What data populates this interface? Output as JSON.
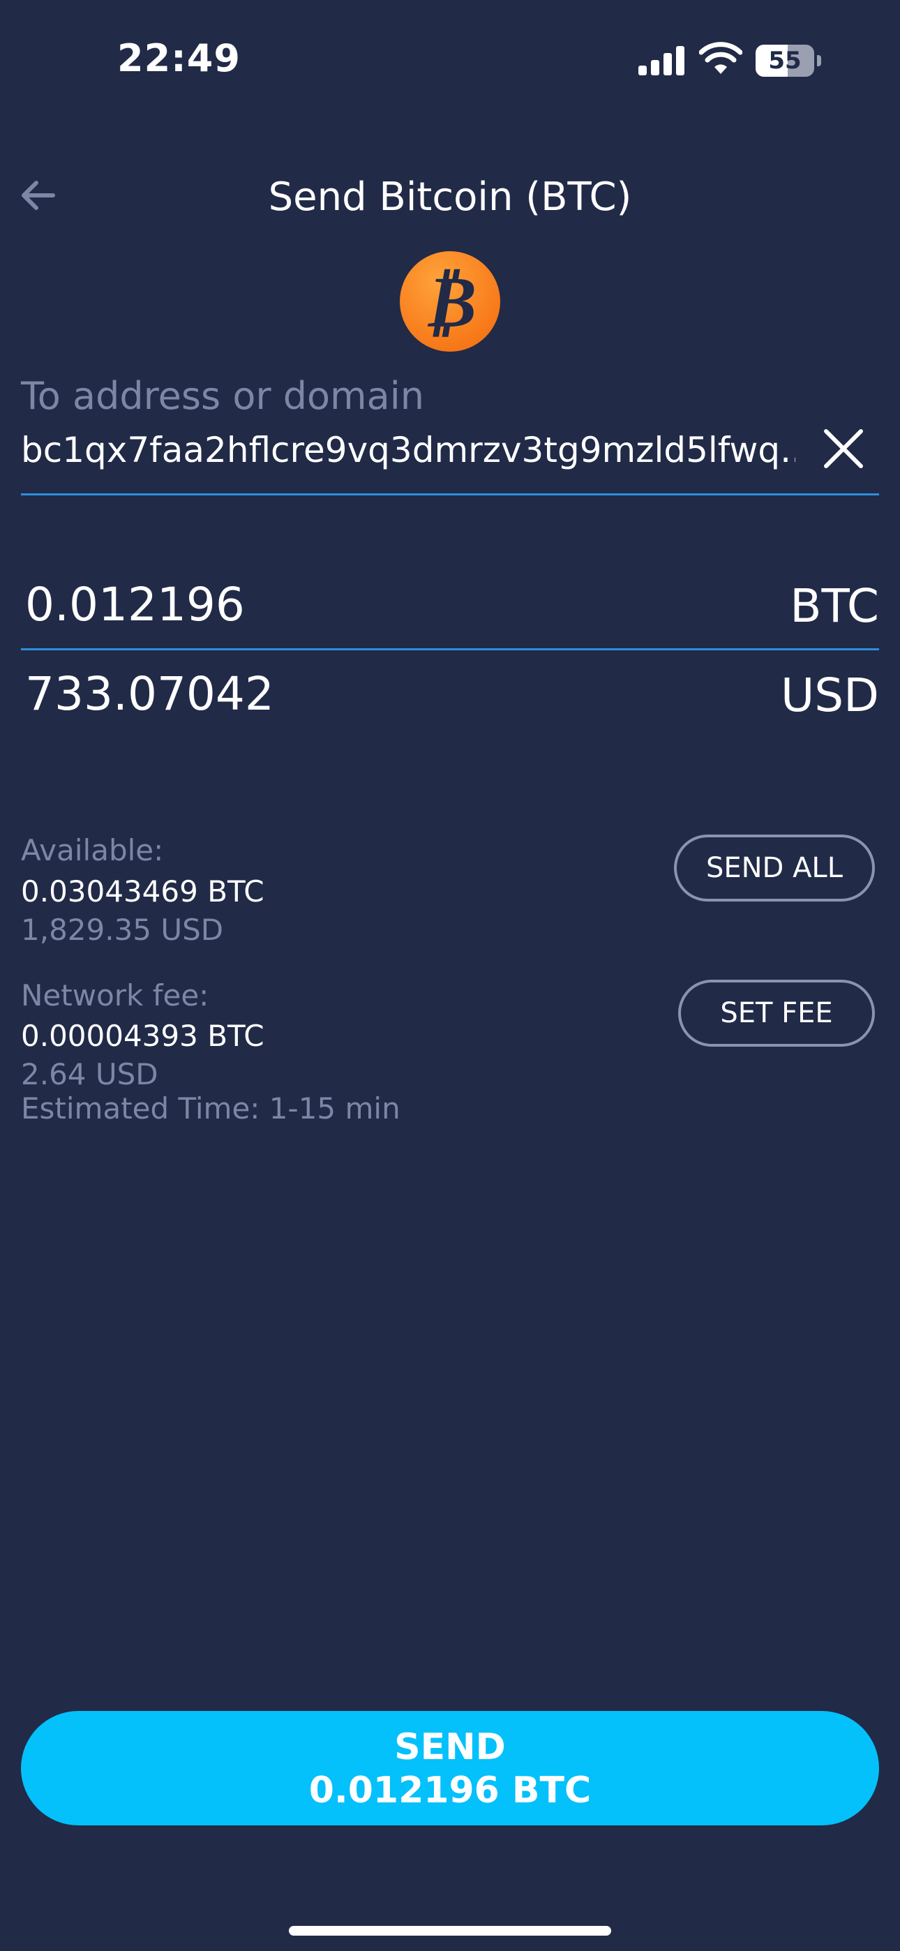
{
  "status_bar": {
    "time": "22:49",
    "battery": "55",
    "battery_level": 0.55
  },
  "header": {
    "title": "Send Bitcoin (BTC)",
    "back_icon": "arrow-left-icon",
    "coin_icon": "bitcoin-icon"
  },
  "address": {
    "label": "To address or domain",
    "value": "bc1qx7faa2hflcre9vq3dmrzv3tg9mzld5lfwq...",
    "clear_icon": "close-icon"
  },
  "amount": {
    "btc_value": "0.012196",
    "btc_unit": "BTC",
    "usd_value": "733.07042",
    "usd_unit": "USD"
  },
  "available": {
    "label": "Available:",
    "btc": "0.03043469 BTC",
    "usd": "1,829.35 USD",
    "button": "SEND ALL"
  },
  "fee": {
    "label": "Network fee:",
    "btc": "0.00004393 BTC",
    "usd": "2.64 USD",
    "time": "Estimated Time: 1-15 min",
    "button": "SET FEE"
  },
  "send": {
    "line1": "SEND",
    "line2": "0.012196 BTC"
  },
  "colors": {
    "background": "#212a47",
    "accent": "#04c0fb",
    "underline": "#2d8fe0",
    "bitcoin": "#f7931a",
    "muted": "#7d87a5"
  }
}
